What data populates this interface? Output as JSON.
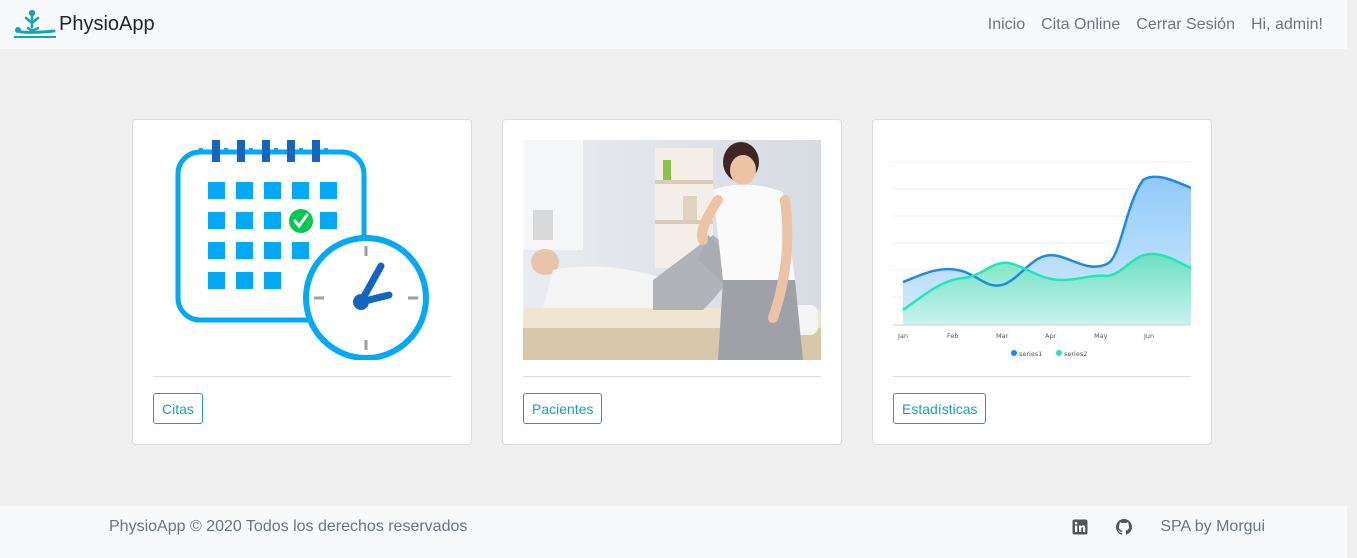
{
  "navbar": {
    "brand": "PhysioApp",
    "links": [
      "Inicio",
      "Cita Online",
      "Cerrar Sesión",
      "Hi, admin!"
    ]
  },
  "cards": [
    {
      "button": "Citas",
      "media": "calendar-clock-icon"
    },
    {
      "button": "Pacientes",
      "media": "physiotherapy-photo"
    },
    {
      "button": "Estadísticas",
      "media": "area-chart-thumbnail"
    }
  ],
  "chart_thumbnail": {
    "categories": [
      "Jan",
      "Feb",
      "Mar",
      "Apr",
      "May",
      "Jun"
    ],
    "legend": [
      "series1",
      "series2"
    ]
  },
  "footer": {
    "copyright": "PhysioApp © 2020 Todos los derechos reservados",
    "credit": "SPA by Morgui",
    "icons": [
      "linkedin-icon",
      "github-icon"
    ]
  },
  "colors": {
    "accent": "#17a2b8",
    "navbar_bg": "#f8f9fa",
    "muted_text": "#6c757d",
    "page_bg": "#f0f0f0",
    "calendar_blue": "#03a9f4"
  }
}
